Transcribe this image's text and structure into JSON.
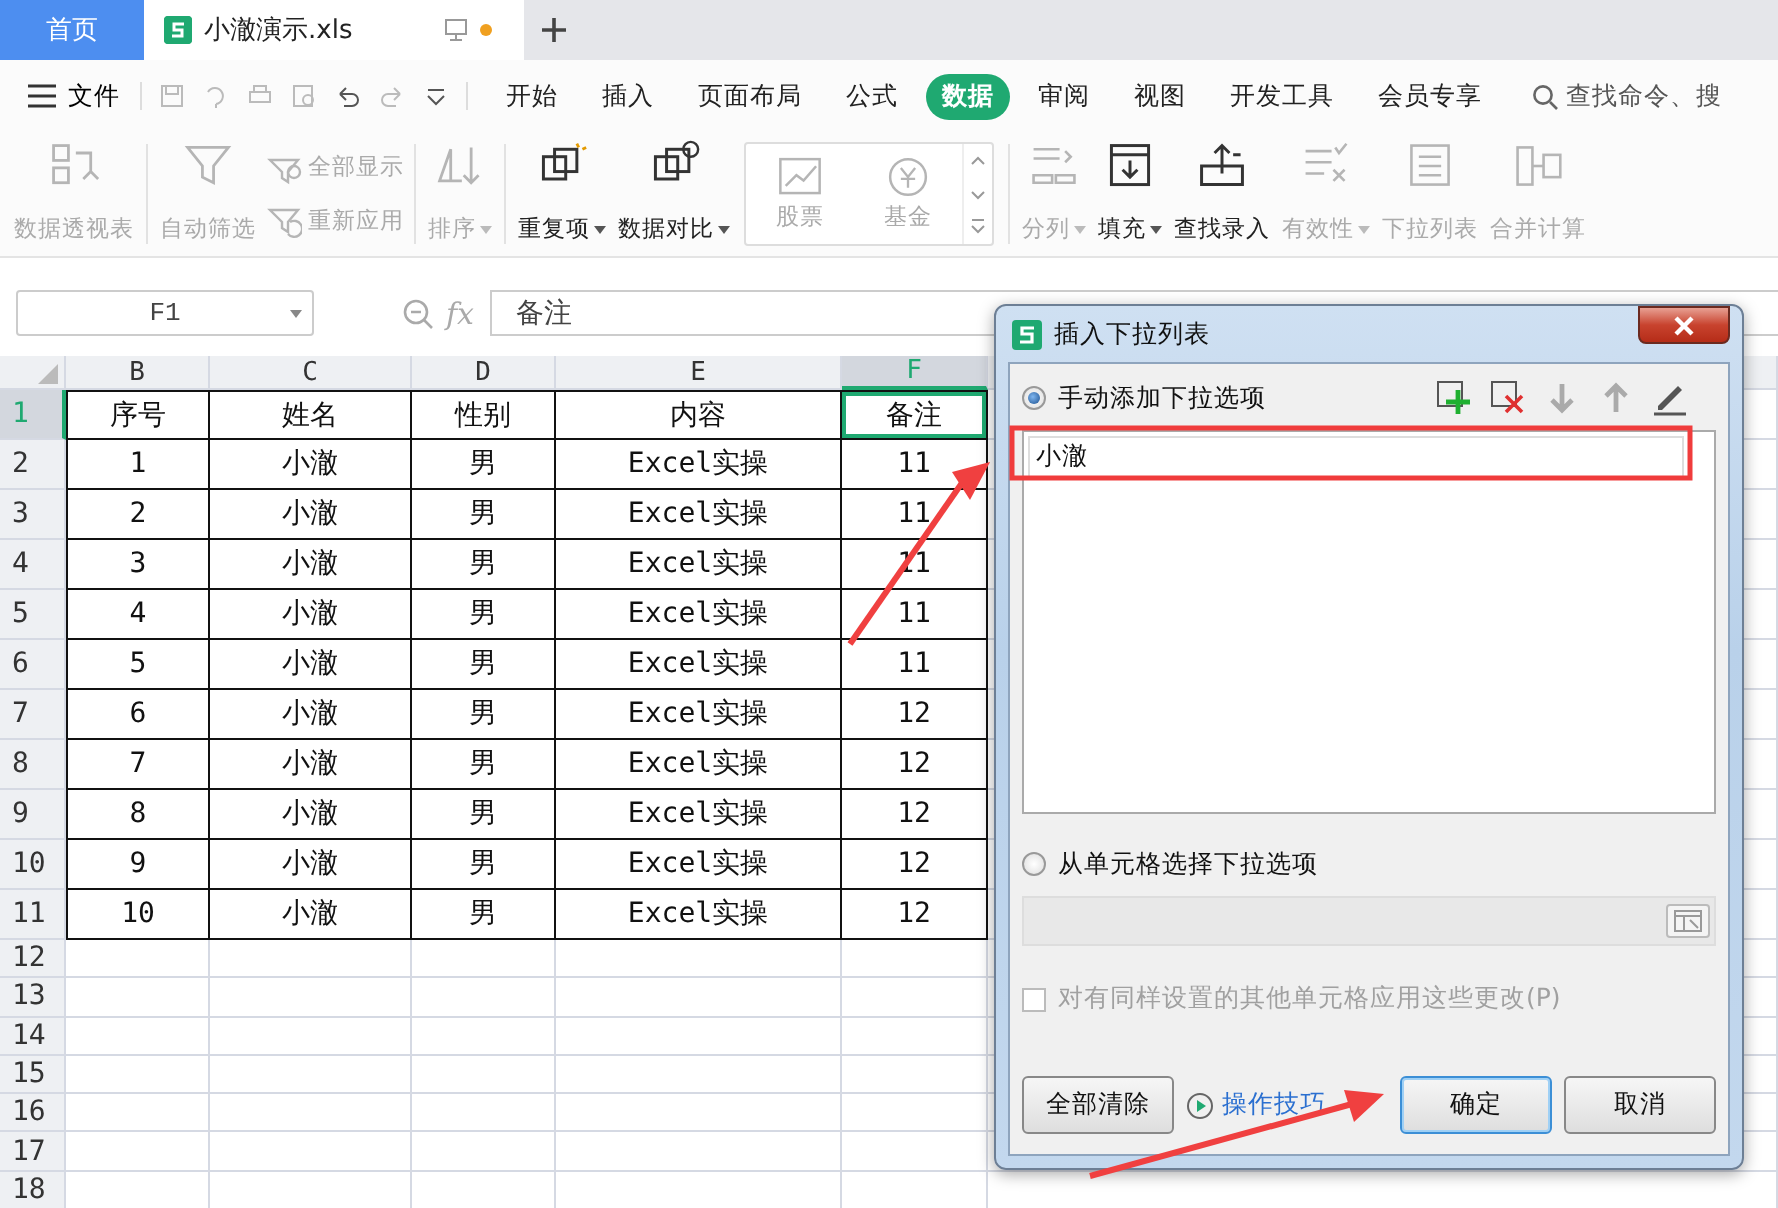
{
  "tabs": [
    {
      "label": "首页",
      "kind": "home",
      "selected": false
    },
    {
      "label": "小澈演示.xls",
      "kind": "file",
      "selected": true,
      "modified": true
    }
  ],
  "menu": {
    "file_label": "文件",
    "tabs": [
      {
        "label": "开始",
        "selected": false
      },
      {
        "label": "插入",
        "selected": false
      },
      {
        "label": "页面布局",
        "selected": false
      },
      {
        "label": "公式",
        "selected": false
      },
      {
        "label": "数据",
        "selected": true
      },
      {
        "label": "审阅",
        "selected": false
      },
      {
        "label": "视图",
        "selected": false
      },
      {
        "label": "开发工具",
        "selected": false
      },
      {
        "label": "会员专享",
        "selected": false
      }
    ],
    "search": {
      "placeholder": "查找命令、搜"
    }
  },
  "ribbon": [
    {
      "kind": "big",
      "label": "数据透视表",
      "disabled": true,
      "dropdown": false
    },
    {
      "kind": "sep"
    },
    {
      "kind": "big",
      "label": "自动筛选",
      "disabled": true,
      "dropdown": false
    },
    {
      "kind": "small",
      "items": [
        {
          "label": "全部显示",
          "disabled": true
        },
        {
          "label": "重新应用",
          "disabled": true
        }
      ]
    },
    {
      "kind": "sep"
    },
    {
      "kind": "big",
      "label": "排序",
      "disabled": true,
      "dropdown": true
    },
    {
      "kind": "sep"
    },
    {
      "kind": "big",
      "label": "重复项",
      "disabled": false,
      "dropdown": true
    },
    {
      "kind": "big",
      "label": "数据对比",
      "disabled": false,
      "dropdown": true
    },
    {
      "kind": "gallery",
      "items": [
        {
          "label": "股票",
          "disabled": true
        },
        {
          "label": "基金",
          "disabled": true
        }
      ]
    },
    {
      "kind": "sep"
    },
    {
      "kind": "big",
      "label": "分列",
      "disabled": true,
      "dropdown": true
    },
    {
      "kind": "big",
      "label": "填充",
      "disabled": false,
      "dropdown": true
    },
    {
      "kind": "big",
      "label": "查找录入",
      "disabled": false,
      "dropdown": false
    },
    {
      "kind": "big",
      "label": "有效性",
      "disabled": true,
      "dropdown": true
    },
    {
      "kind": "big",
      "label": "下拉列表",
      "disabled": true,
      "dropdown": false
    },
    {
      "kind": "big",
      "label": "合并计算",
      "disabled": true,
      "dropdown": false
    }
  ],
  "formula_bar": {
    "name_box": "F1",
    "fx_label": "fx",
    "value": "备注"
  },
  "sheet": {
    "columns": [
      {
        "label": "B",
        "selected": false
      },
      {
        "label": "C",
        "selected": false
      },
      {
        "label": "D",
        "selected": false
      },
      {
        "label": "E",
        "selected": false
      },
      {
        "label": "F",
        "selected": true
      }
    ],
    "rows": [
      {
        "number": "1",
        "selected": true,
        "cells": [
          {
            "text": "序号",
            "selected": false
          },
          {
            "text": "姓名",
            "selected": false
          },
          {
            "text": "性别",
            "selected": false
          },
          {
            "text": "内容",
            "selected": false
          },
          {
            "text": "备注",
            "selected": true
          }
        ]
      },
      {
        "number": "2",
        "selected": false,
        "cells": [
          {
            "text": "1",
            "selected": false
          },
          {
            "text": "小澈",
            "selected": false
          },
          {
            "text": "男",
            "selected": false
          },
          {
            "text": "Excel实操",
            "selected": false
          },
          {
            "text": "11",
            "selected": false
          }
        ]
      },
      {
        "number": "3",
        "selected": false,
        "cells": [
          {
            "text": "2",
            "selected": false
          },
          {
            "text": "小澈",
            "selected": false
          },
          {
            "text": "男",
            "selected": false
          },
          {
            "text": "Excel实操",
            "selected": false
          },
          {
            "text": "11",
            "selected": false
          }
        ]
      },
      {
        "number": "4",
        "selected": false,
        "cells": [
          {
            "text": "3",
            "selected": false
          },
          {
            "text": "小澈",
            "selected": false
          },
          {
            "text": "男",
            "selected": false
          },
          {
            "text": "Excel实操",
            "selected": false
          },
          {
            "text": "11",
            "selected": false
          }
        ]
      },
      {
        "number": "5",
        "selected": false,
        "cells": [
          {
            "text": "4",
            "selected": false
          },
          {
            "text": "小澈",
            "selected": false
          },
          {
            "text": "男",
            "selected": false
          },
          {
            "text": "Excel实操",
            "selected": false
          },
          {
            "text": "11",
            "selected": false
          }
        ]
      },
      {
        "number": "6",
        "selected": false,
        "cells": [
          {
            "text": "5",
            "selected": false
          },
          {
            "text": "小澈",
            "selected": false
          },
          {
            "text": "男",
            "selected": false
          },
          {
            "text": "Excel实操",
            "selected": false
          },
          {
            "text": "11",
            "selected": false
          }
        ]
      },
      {
        "number": "7",
        "selected": false,
        "cells": [
          {
            "text": "6",
            "selected": false
          },
          {
            "text": "小澈",
            "selected": false
          },
          {
            "text": "男",
            "selected": false
          },
          {
            "text": "Excel实操",
            "selected": false
          },
          {
            "text": "12",
            "selected": false
          }
        ]
      },
      {
        "number": "8",
        "selected": false,
        "cells": [
          {
            "text": "7",
            "selected": false
          },
          {
            "text": "小澈",
            "selected": false
          },
          {
            "text": "男",
            "selected": false
          },
          {
            "text": "Excel实操",
            "selected": false
          },
          {
            "text": "12",
            "selected": false
          }
        ]
      },
      {
        "number": "9",
        "selected": false,
        "cells": [
          {
            "text": "8",
            "selected": false
          },
          {
            "text": "小澈",
            "selected": false
          },
          {
            "text": "男",
            "selected": false
          },
          {
            "text": "Excel实操",
            "selected": false
          },
          {
            "text": "12",
            "selected": false
          }
        ]
      },
      {
        "number": "10",
        "selected": false,
        "cells": [
          {
            "text": "9",
            "selected": false
          },
          {
            "text": "小澈",
            "selected": false
          },
          {
            "text": "男",
            "selected": false
          },
          {
            "text": "Excel实操",
            "selected": false
          },
          {
            "text": "12",
            "selected": false
          }
        ]
      },
      {
        "number": "11",
        "selected": false,
        "cells": [
          {
            "text": "10",
            "selected": false
          },
          {
            "text": "小澈",
            "selected": false
          },
          {
            "text": "男",
            "selected": false
          },
          {
            "text": "Excel实操",
            "selected": false
          },
          {
            "text": "12",
            "selected": false
          }
        ]
      },
      {
        "number": "12",
        "selected": false
      },
      {
        "number": "13",
        "selected": false
      },
      {
        "number": "14",
        "selected": false
      },
      {
        "number": "15",
        "selected": false
      },
      {
        "number": "16",
        "selected": false
      },
      {
        "number": "17",
        "selected": false
      },
      {
        "number": "18",
        "selected": false
      }
    ]
  },
  "dialog": {
    "title": "插入下拉列表",
    "options": [
      {
        "label": "手动添加下拉选项",
        "selected": true
      },
      {
        "label": "从单元格选择下拉选项",
        "selected": false
      }
    ],
    "tools": [
      {
        "kind": "add",
        "disabled": false
      },
      {
        "kind": "delete",
        "disabled": false
      },
      {
        "kind": "down",
        "disabled": true
      },
      {
        "kind": "up",
        "disabled": true
      },
      {
        "kind": "edit",
        "disabled": false
      }
    ],
    "items": [
      "小澈"
    ],
    "range_field": {
      "disabled": true
    },
    "apply_all": {
      "label": "对有同样设置的其他单元格应用这些更改(P)",
      "checked": false,
      "disabled": true
    },
    "clear_button": "全部清除",
    "tips_link": "操作技巧",
    "buttons": [
      {
        "label": "确定",
        "default": true
      },
      {
        "label": "取消",
        "default": false
      }
    ]
  }
}
